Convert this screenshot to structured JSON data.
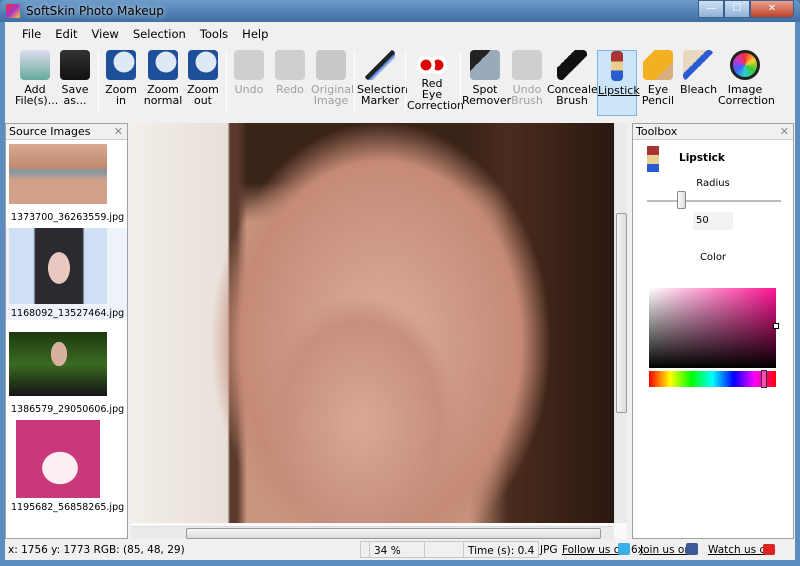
{
  "window": {
    "title": "SoftSkin Photo Makeup",
    "minimize": "—",
    "maximize": "☐",
    "close": "✕"
  },
  "menu": [
    "File",
    "Edit",
    "View",
    "Selection",
    "Tools",
    "Help"
  ],
  "toolbar": [
    {
      "label": "Add\nFile(s)...",
      "icon": "add-files-icon",
      "state": "normal"
    },
    {
      "label": "Save\nas...",
      "icon": "save-icon",
      "state": "normal"
    },
    {
      "label": "Zoom\nin",
      "icon": "zoom-in-icon",
      "state": "normal"
    },
    {
      "label": "Zoom\nnormal",
      "icon": "zoom-normal-icon",
      "state": "normal"
    },
    {
      "label": "Zoom\nout",
      "icon": "zoom-out-icon",
      "state": "normal"
    },
    {
      "label": "Undo",
      "icon": "undo-icon",
      "state": "disabled"
    },
    {
      "label": "Redo",
      "icon": "redo-icon",
      "state": "disabled"
    },
    {
      "label": "Original\nImage",
      "icon": "original-image-icon",
      "state": "disabled"
    },
    {
      "label": "Selection\nMarker",
      "icon": "selection-marker-icon",
      "state": "normal"
    },
    {
      "label": "Red\nEye\nCorrection",
      "icon": "red-eye-icon",
      "state": "normal"
    },
    {
      "label": "Spot\nRemover",
      "icon": "spot-remover-icon",
      "state": "normal"
    },
    {
      "label": "Undo\nBrush",
      "icon": "undo-brush-icon",
      "state": "disabled"
    },
    {
      "label": "Concealer\nBrush",
      "icon": "concealer-brush-icon",
      "state": "normal"
    },
    {
      "label": "Lipstick",
      "icon": "lipstick-icon",
      "state": "selected"
    },
    {
      "label": "Eye\nPencil",
      "icon": "eye-pencil-icon",
      "state": "normal"
    },
    {
      "label": "Bleach",
      "icon": "bleach-icon",
      "state": "normal"
    },
    {
      "label": "Image\nCorrection",
      "icon": "image-correction-icon",
      "state": "normal"
    }
  ],
  "source_panel": {
    "title": "Source Images",
    "close": "✕",
    "files": [
      "1373700_36263559.jpg",
      "1168092_13527464.jpg",
      "1386579_29050606.jpg",
      "1195682_56858265.jpg"
    ]
  },
  "toolbox": {
    "title": "Toolbox",
    "close": "✕",
    "tool": "Lipstick",
    "radius_label": "Radius",
    "radius_value": "50",
    "radius_fraction": 0.25,
    "color_label": "Color",
    "selected_color": "#e0127f"
  },
  "status": {
    "coords": "x: 1756 y: 1773  RGB: (85, 48, 29)",
    "zoom": "34 %",
    "time": "Time (s): 0.4",
    "format": "JPG",
    "follow": "Follow us on",
    "dims": "6x",
    "join": "Join us on",
    "watch": "Watch us on"
  }
}
